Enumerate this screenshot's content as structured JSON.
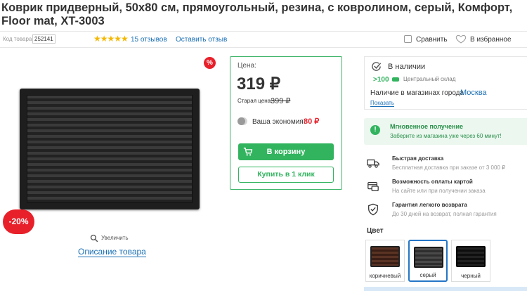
{
  "product": {
    "title": "Коврик придверный, 50x80 см, прямоугольный, резина, с ковролином, серый, Комфорт, Floor mat, XT-3003"
  },
  "meta": {
    "code_label": "Код товара:",
    "code_value": "252141",
    "stars": "★★★★★",
    "reviews": "15 отзывов",
    "leave_review": "Оставить отзыв",
    "compare": "Сравнить",
    "favorite": "В избранное"
  },
  "gallery": {
    "sale_badge": "%",
    "discount": "-20%",
    "zoom": "Увеличить",
    "description_link": "Описание товара"
  },
  "price": {
    "label": "Цена:",
    "current": "319 ₽",
    "old_label": "Старая цена:",
    "old": "399 ₽",
    "savings_label": "Ваша экономия:",
    "savings": "80 ₽",
    "cart_button": "В корзину",
    "one_click_button": "Купить в 1 клик"
  },
  "stock": {
    "status": "В наличии",
    "quantity": ">100",
    "warehouse": "Центральный склад",
    "city_label": "Наличие в магазинах города",
    "city": "Москва",
    "show": "Показать"
  },
  "instant": {
    "title": "Мгновенное получение",
    "subtitle": "Заберите из магазина уже через 60 минут!"
  },
  "features": [
    {
      "title": "Быстрая доставка",
      "subtitle": "Бесплатная доставка при заказе от 3 000 ₽"
    },
    {
      "title": "Возможность оплаты картой",
      "subtitle": "На сайте или при получении заказа"
    },
    {
      "title": "Гарантия легкого возврата",
      "subtitle": "До 30 дней на возврат, полная гарантия"
    }
  ],
  "colors": {
    "label": "Цвет",
    "options": [
      {
        "name": "коричневый",
        "color": "#4a2a1e"
      },
      {
        "name": "серый",
        "color": "#3a3a3a"
      },
      {
        "name": "черный",
        "color": "#141414"
      }
    ],
    "selected": "серый"
  },
  "theme": {
    "accent_green": "#32b45f",
    "sale_red": "#e8202a",
    "link_blue": "#1a6fb5"
  }
}
